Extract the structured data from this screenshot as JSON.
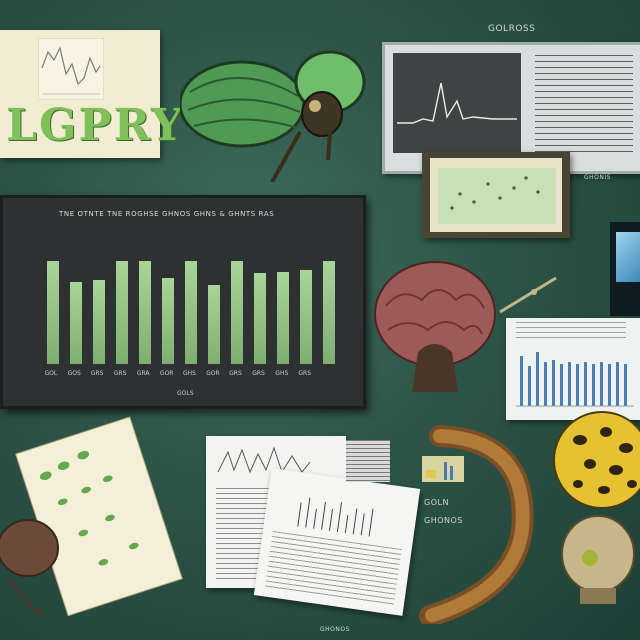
{
  "logo": {
    "text": "LGPRY"
  },
  "labels": {
    "top_caption": "GOLROSS",
    "side_caption_1": "GHONIS",
    "side_caption_2": "GOLN",
    "side_caption_3": "GHONOS",
    "bottom_caption": "GHONOS"
  },
  "chart_data": {
    "type": "bar",
    "title": "TNE OTNTE TNE ROGHSE GHNOS GHNS & GHNTS RAS",
    "categories": [
      "GOL",
      "GOS",
      "GRS",
      "GRS",
      "GRA",
      "GOR",
      "GHS",
      "GOR",
      "GRS",
      "GRS",
      "GHS",
      "GRS"
    ],
    "values": [
      82,
      65,
      67,
      82,
      82,
      68,
      82,
      63,
      82,
      72,
      73,
      75,
      82
    ],
    "ylim": [
      0,
      100
    ],
    "xlabel": "GOLS",
    "ylabel": ""
  },
  "colors": {
    "background": "#2c5446",
    "bar": "#95c486",
    "logo": "#7fc05a",
    "panel": "#2e3132"
  }
}
